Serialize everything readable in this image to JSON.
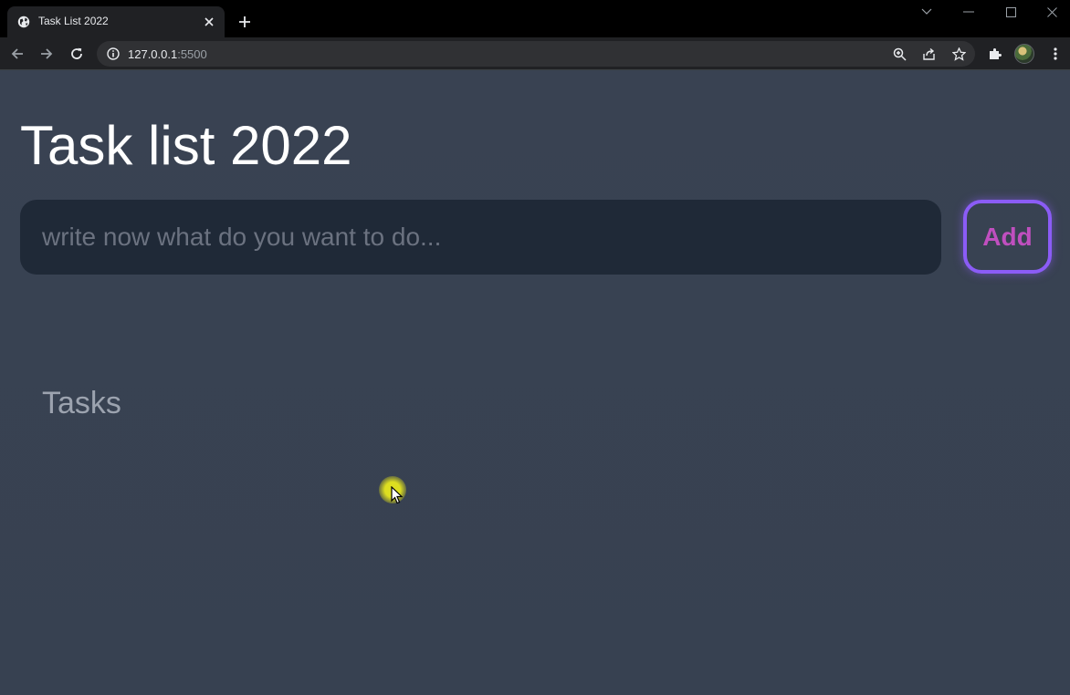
{
  "browser": {
    "tab_title": "Task List 2022",
    "url_host": "127.0.0.1",
    "url_port": ":5500",
    "icons": {
      "favicon": "globe-icon",
      "close": "close-icon",
      "new_tab": "plus-icon",
      "back": "back-arrow-icon",
      "forward": "forward-arrow-icon",
      "reload": "reload-icon",
      "site_info": "info-icon",
      "zoom": "zoom-icon",
      "share": "share-icon",
      "bookmark": "star-icon",
      "extensions": "puzzle-icon",
      "menu": "kebab-menu-icon"
    }
  },
  "app": {
    "title": "Task list 2022",
    "input_placeholder": "write now what do you want to do...",
    "input_value": "",
    "add_label": "Add",
    "tasks_heading": "Tasks"
  },
  "colors": {
    "page_background": "#374151",
    "input_background": "#1f2937",
    "add_border": "#8b5cf6",
    "add_text": "#c04fbf",
    "heading": "#ffffff",
    "tasks_heading": "#9ca3af"
  }
}
